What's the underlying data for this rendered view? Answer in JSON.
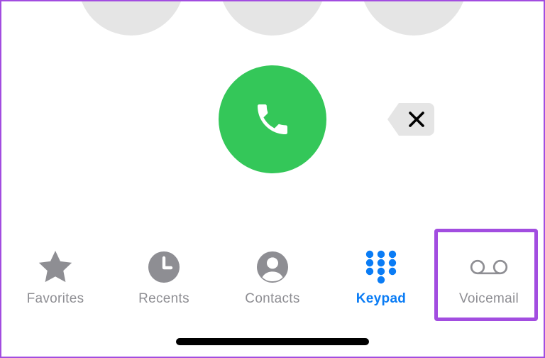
{
  "keypad": {
    "visible_keys": [
      {
        "symbol": ""
      },
      {
        "symbol": "+"
      },
      {
        "symbol": ""
      }
    ]
  },
  "call_button": {
    "icon": "phone-icon",
    "color": "#34c759"
  },
  "delete_button": {
    "icon": "close-icon"
  },
  "tabs": [
    {
      "label": "Favorites",
      "icon": "star-icon",
      "active": false
    },
    {
      "label": "Recents",
      "icon": "clock-icon",
      "active": false
    },
    {
      "label": "Contacts",
      "icon": "person-icon",
      "active": false
    },
    {
      "label": "Keypad",
      "icon": "keypad-icon",
      "active": true
    },
    {
      "label": "Voicemail",
      "icon": "voicemail-icon",
      "active": false
    }
  ],
  "colors": {
    "active": "#0a7cf5",
    "inactive": "#8e8e93",
    "highlight": "#a24de0"
  }
}
